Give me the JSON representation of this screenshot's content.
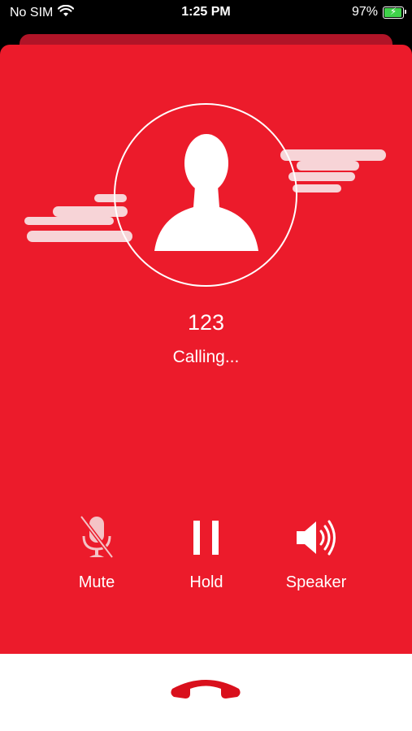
{
  "status_bar": {
    "carrier": "No SIM",
    "time": "1:25 PM",
    "battery_percent": "97%",
    "battery_level": 0.97
  },
  "call": {
    "caller": "123",
    "status": "Calling..."
  },
  "controls": {
    "mute_label": "Mute",
    "hold_label": "Hold",
    "speaker_label": "Speaker"
  },
  "colors": {
    "background": "#ec1b2b",
    "end_call": "#d9101c",
    "battery": "#3fd24a"
  },
  "icons": {
    "avatar": "person-silhouette-icon",
    "mute": "mic-off-icon",
    "hold": "pause-icon",
    "speaker": "speaker-icon",
    "end_call": "phone-hangup-icon"
  }
}
